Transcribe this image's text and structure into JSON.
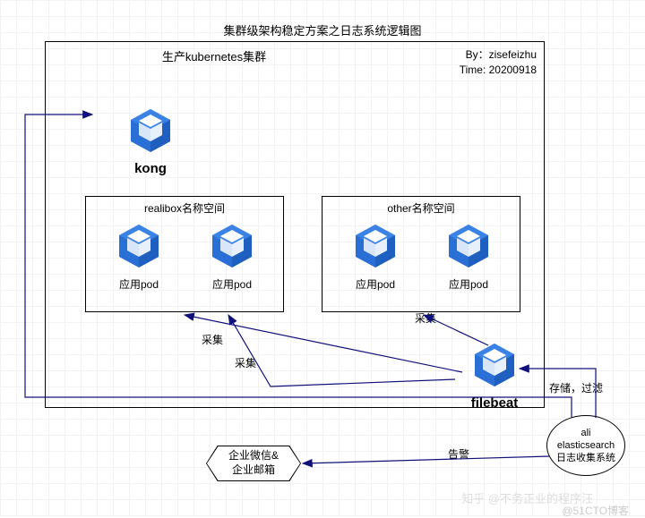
{
  "title": "集群级架构稳定方案之日志系统逻辑图",
  "cluster": {
    "name": "生产kubernetes集群",
    "by_label": "By：zisefeizhu",
    "time_label": "Time: 20200918"
  },
  "nodes": {
    "kong": "kong",
    "filebeat": "filebeat",
    "es_line1": "ali",
    "es_line2": "elasticsearch",
    "es_line3": "日志收集系统",
    "wechat_mail": "企业微信&\n企业邮箱"
  },
  "namespaces": {
    "realibox": {
      "title": "realibox名称空间",
      "pods": [
        "应用pod",
        "应用pod"
      ]
    },
    "other": {
      "title": "other名称空间",
      "pods": [
        "应用pod",
        "应用pod"
      ]
    }
  },
  "edges": {
    "collect1": "采集",
    "collect2": "采集",
    "collect3": "采集",
    "store_filter": "存储，过滤",
    "alert": "告警"
  },
  "watermark_zhihu": "知乎 @不务正业的程序汪",
  "watermark_51cto": "@51CTO博客"
}
